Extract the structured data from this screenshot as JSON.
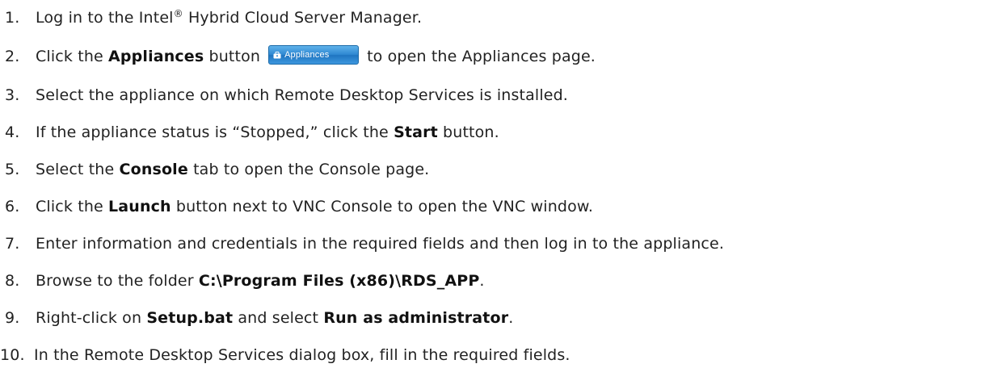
{
  "steps": [
    {
      "num": "1.",
      "segments": [
        "Log in to the Intel",
        "®",
        " Hybrid Cloud Server Manager."
      ]
    },
    {
      "num": "2.",
      "pre": "Click the ",
      "bold1": "Appliances",
      "mid": " button",
      "button_label": "Appliances",
      "button_icon": "appliance-icon",
      "post": " to open the Appliances page."
    },
    {
      "num": "3.",
      "text": "Select the appliance on which Remote Desktop Services is installed."
    },
    {
      "num": "4.",
      "pre": "If the appliance status is “Stopped,” click the ",
      "bold1": "Start",
      "post": " button."
    },
    {
      "num": "5.",
      "pre": "Select the ",
      "bold1": "Console",
      "post": " tab to open the Console page."
    },
    {
      "num": "6.",
      "pre": "Click the ",
      "bold1": "Launch",
      "post": " button next to VNC Console to open the VNC window."
    },
    {
      "num": "7.",
      "text": "Enter information and credentials in the required fields and then log in to the appliance."
    },
    {
      "num": "8.",
      "pre": "Browse to the folder ",
      "bold1": "C:\\Program Files (x86)\\RDS_APP",
      "post": "."
    },
    {
      "num": "9.",
      "pre": "Right-click on ",
      "bold1": "Setup.bat",
      "mid": " and select ",
      "bold2": "Run as administrator",
      "post": "."
    },
    {
      "num": "10.",
      "text": "In the Remote Desktop Services dialog box, fill in the required fields."
    }
  ],
  "colors": {
    "text": "#222222",
    "button_gradient_top": "#5fb2ea",
    "button_gradient_bottom": "#1f75c1"
  }
}
